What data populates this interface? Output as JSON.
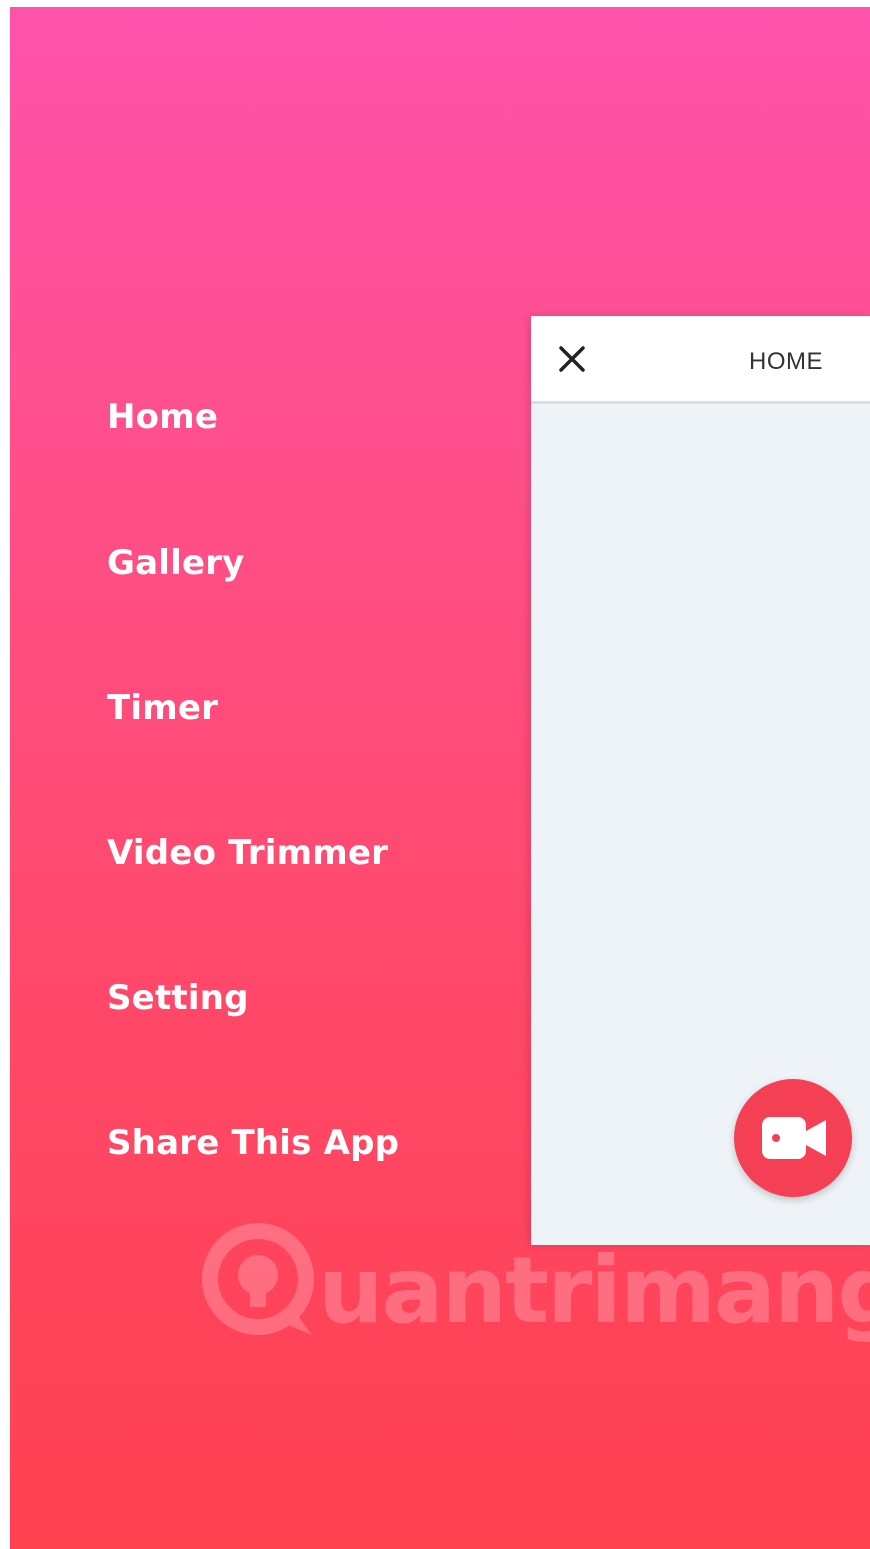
{
  "menu": {
    "items": [
      {
        "label": "Home"
      },
      {
        "label": "Gallery"
      },
      {
        "label": "Timer"
      },
      {
        "label": "Video Trimmer"
      },
      {
        "label": "Setting"
      },
      {
        "label": "Share This App"
      }
    ]
  },
  "preview": {
    "title": "HOME",
    "close_icon": "close-icon",
    "fab_icon": "video-camera-icon"
  },
  "watermark": {
    "text": "uantrimang"
  },
  "colors": {
    "gradient_top": "#ff52ab",
    "gradient_bottom": "#ff4150",
    "fab": "#f43f55",
    "preview_bg": "#eef3f7"
  }
}
